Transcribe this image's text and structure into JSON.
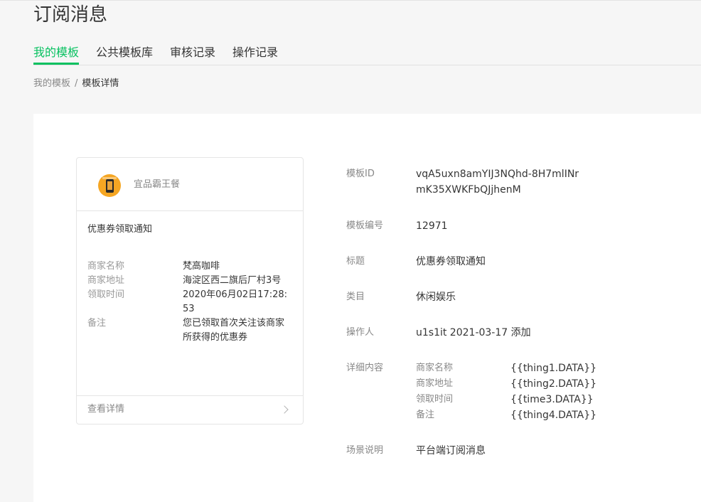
{
  "page": {
    "title": "订阅消息",
    "tabs": [
      "我的模板",
      "公共模板库",
      "审核记录",
      "操作记录"
    ],
    "active_tab": "我的模板"
  },
  "breadcrumb": {
    "parent": "我的模板",
    "separator": "/",
    "current": "模板详情"
  },
  "preview": {
    "shop_name": "宜品霸王餐",
    "title": "优惠券领取通知",
    "fields": [
      {
        "key": "商家名称",
        "value": "梵高咖啡"
      },
      {
        "key": "商家地址",
        "value": "海淀区西二旗后厂村3号"
      },
      {
        "key": "领取时间",
        "value": "2020年06月02日17:28:53"
      },
      {
        "key": "备注",
        "value": "您已领取首次关注该商家所获得的优惠券"
      }
    ],
    "view_details": "查看详情"
  },
  "details": {
    "template_id": {
      "label": "模板ID",
      "value": "vqA5uxn8amYIJ3NQhd-8H7mlINrmK35XWKFbQJjhenM"
    },
    "template_no": {
      "label": "模板编号",
      "value": "12971"
    },
    "title": {
      "label": "标题",
      "value": "优惠券领取通知"
    },
    "category": {
      "label": "类目",
      "value": "休闲娱乐"
    },
    "operator": {
      "label": "操作人",
      "value": "u1s1it 2021-03-17 添加"
    },
    "content": {
      "label": "详细内容",
      "items": [
        {
          "key": "商家名称",
          "value": "{{thing1.DATA}}"
        },
        {
          "key": "商家地址",
          "value": "{{thing2.DATA}}"
        },
        {
          "key": "领取时间",
          "value": "{{time3.DATA}}"
        },
        {
          "key": "备注",
          "value": "{{thing4.DATA}}"
        }
      ]
    },
    "scene": {
      "label": "场景说明",
      "value": "平台端订阅消息"
    }
  }
}
